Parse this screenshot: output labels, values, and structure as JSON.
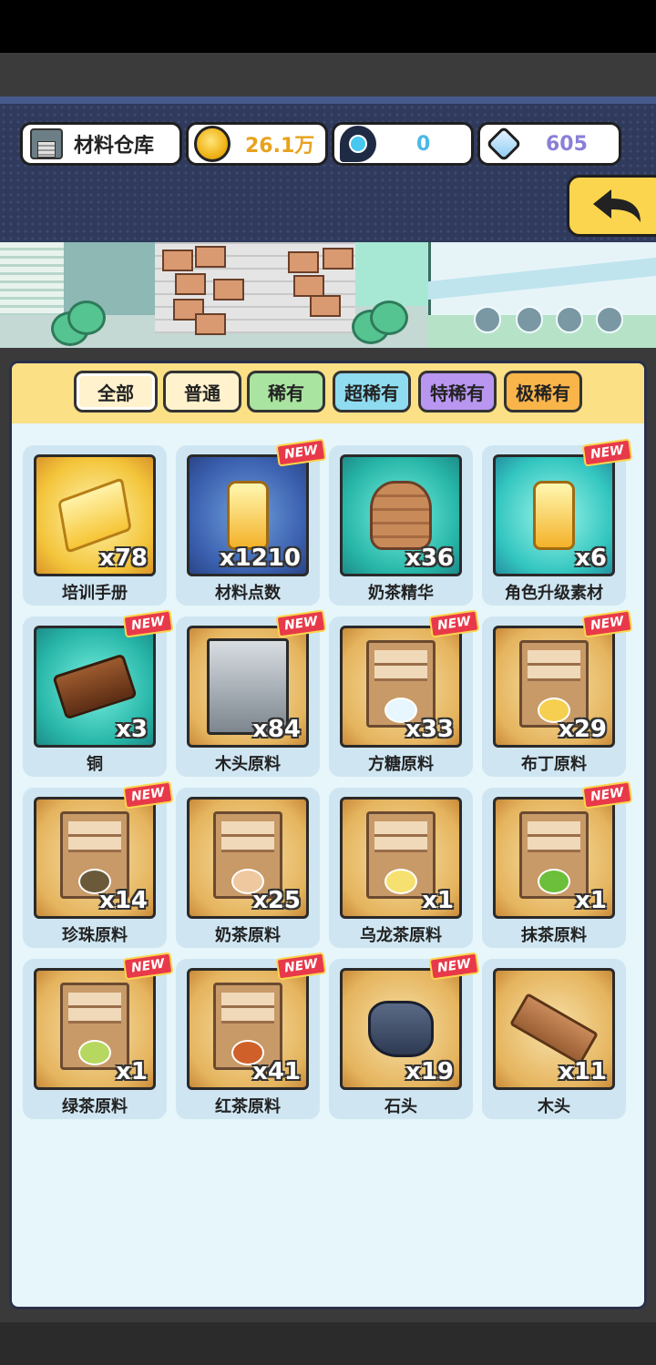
{
  "header": {
    "title": "材料仓库",
    "gold": "26.1万",
    "potion": "0",
    "gems": "605"
  },
  "tabs": [
    {
      "label": "全部",
      "color": "#fff2cc",
      "active": true
    },
    {
      "label": "普通",
      "color": "#fff2cc"
    },
    {
      "label": "稀有",
      "color": "#a9e4a0"
    },
    {
      "label": "超稀有",
      "color": "#8fdcf0"
    },
    {
      "label": "特稀有",
      "color": "#b996f0"
    },
    {
      "label": "极稀有",
      "color": "#f9b54a"
    }
  ],
  "new_badge": "NEW",
  "items": [
    {
      "name": "培训手册",
      "count": "x78",
      "bg": "gold",
      "icon": "book-icon",
      "new": false
    },
    {
      "name": "材料点数",
      "count": "x1210",
      "bg": "blue",
      "icon": "bottle-icon",
      "new": true
    },
    {
      "name": "奶茶精华",
      "count": "x36",
      "bg": "teal",
      "icon": "jar-icon",
      "new": false
    },
    {
      "name": "角色升级素材",
      "count": "x6",
      "bg": "cyan",
      "icon": "bottle-icon",
      "new": true
    },
    {
      "name": "铜",
      "count": "x3",
      "bg": "teal",
      "icon": "copper-ingot-icon",
      "new": true
    },
    {
      "name": "木头原料",
      "count": "x84",
      "bg": "parch",
      "icon": "metal-crate-icon",
      "new": true
    },
    {
      "name": "方糖原料",
      "count": "x33",
      "bg": "parch",
      "icon": "sugar-crate-icon",
      "new": true
    },
    {
      "name": "布丁原料",
      "count": "x29",
      "bg": "parch",
      "icon": "pudding-crate-icon",
      "new": true
    },
    {
      "name": "珍珠原料",
      "count": "x14",
      "bg": "parch",
      "icon": "pearl-crate-icon",
      "new": true
    },
    {
      "name": "奶茶原料",
      "count": "x25",
      "bg": "parch",
      "icon": "milktea-crate-icon",
      "new": false
    },
    {
      "name": "乌龙茶原料",
      "count": "x1",
      "bg": "parch",
      "icon": "oolong-crate-icon",
      "new": false
    },
    {
      "name": "抹茶原料",
      "count": "x1",
      "bg": "parch",
      "icon": "matcha-crate-icon",
      "new": true
    },
    {
      "name": "绿茶原料",
      "count": "x1",
      "bg": "parch",
      "icon": "greentea-crate-icon",
      "new": true
    },
    {
      "name": "红茶原料",
      "count": "x41",
      "bg": "parch",
      "icon": "blacktea-crate-icon",
      "new": true
    },
    {
      "name": "石头",
      "count": "x19",
      "bg": "parch",
      "icon": "stone-icon",
      "new": true
    },
    {
      "name": "木头",
      "count": "x11",
      "bg": "parch",
      "icon": "plank-icon",
      "new": false
    }
  ]
}
